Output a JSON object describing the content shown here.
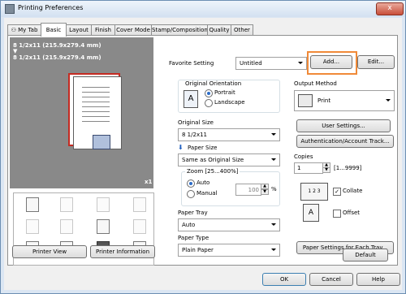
{
  "window": {
    "title": "Printing Preferences"
  },
  "tabs": [
    "My Tab",
    "Basic",
    "Layout",
    "Finish",
    "Cover Mode",
    "Stamp/Composition",
    "Quality",
    "Other"
  ],
  "preview": {
    "text1": "8 1/2x11 (215.9x279.4 mm)",
    "text2": "8 1/2x11 (215.9x279.4 mm)",
    "copies_mark": "x1"
  },
  "favorite": {
    "label": "Favorite Setting",
    "value": "Untitled",
    "add": "Add...",
    "edit": "Edit..."
  },
  "orientation": {
    "label": "Original Orientation",
    "portrait": "Portrait",
    "landscape": "Landscape",
    "selected": "Portrait"
  },
  "original_size": {
    "label": "Original Size",
    "value": "8 1/2x11"
  },
  "paper_size": {
    "label": "Paper Size",
    "value": "Same as Original Size"
  },
  "zoom": {
    "label": "Zoom [25...400%]",
    "auto": "Auto",
    "manual": "Manual",
    "value": "100",
    "unit": "%",
    "selected": "Auto"
  },
  "paper_tray": {
    "label": "Paper Tray",
    "value": "Auto"
  },
  "paper_type": {
    "label": "Paper Type",
    "value": "Plain Paper"
  },
  "output": {
    "label": "Output Method",
    "value": "Print",
    "user_settings": "User Settings...",
    "auth": "Authentication/Account Track..."
  },
  "copies": {
    "label": "Copies",
    "value": "1",
    "range": "[1...9999]",
    "collate": "Collate",
    "collate_checked": true,
    "offset": "Offset",
    "offset_checked": false
  },
  "paper_each_tray": "Paper Settings for Each Tray...",
  "printer_view": "Printer View",
  "printer_info": "Printer Information",
  "default": "Default",
  "footer": {
    "ok": "OK",
    "cancel": "Cancel",
    "help": "Help"
  },
  "title_buttons": {
    "close": "x"
  }
}
